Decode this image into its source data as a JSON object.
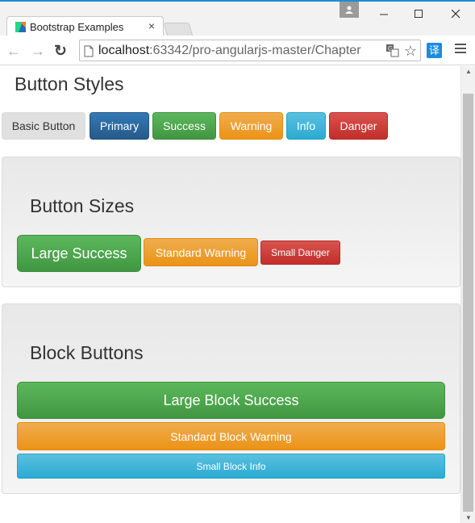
{
  "browser": {
    "tab_title": "Bootstrap Examples",
    "tab_close": "×",
    "url_host": "localhost",
    "url_rest": ":63342/pro-angularjs-master/Chapter",
    "extension_label": "译",
    "star_glyph": "☆",
    "back_glyph": "←",
    "forward_glyph": "→",
    "reload_glyph": "↻"
  },
  "page": {
    "button_styles": {
      "heading": "Button Styles",
      "buttons": [
        "Basic Button",
        "Primary",
        "Success",
        "Warning",
        "Info",
        "Danger"
      ]
    },
    "button_sizes": {
      "heading": "Button Sizes",
      "large": "Large Success",
      "standard": "Standard Warning",
      "small": "Small Danger"
    },
    "block_buttons": {
      "heading": "Block Buttons",
      "large": "Large Block Success",
      "standard": "Standard Block Warning",
      "small": "Small Block Info"
    }
  },
  "colors": {
    "primary": "#337ab7",
    "success": "#5cb85c",
    "warning": "#f0ad4e",
    "info": "#5bc0de",
    "danger": "#d9534f"
  }
}
